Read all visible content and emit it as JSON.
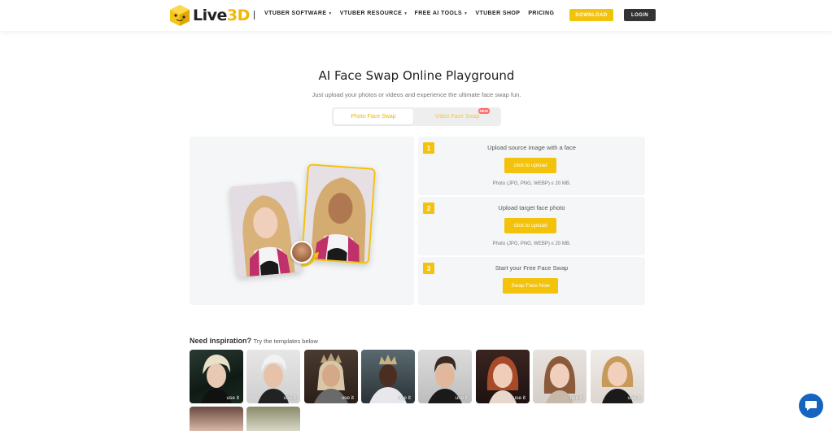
{
  "header": {
    "logo_text_main": "Live",
    "logo_text_accent": "3D",
    "nav": [
      {
        "label": "VTUBER SOFTWARE",
        "has_dropdown": true
      },
      {
        "label": "VTUBER RESOURCE",
        "has_dropdown": true
      },
      {
        "label": "FREE AI TOOLS",
        "has_dropdown": true
      },
      {
        "label": "VTUBER SHOP",
        "has_dropdown": false
      },
      {
        "label": "PRICING",
        "has_dropdown": false
      }
    ],
    "download_label": "DOWNLOAD",
    "login_label": "LOGIN"
  },
  "hero": {
    "title": "AI Face Swap Online Playground",
    "subtitle": "Just upload your photos or videos and experience the ultimate face swap fun."
  },
  "tabs": {
    "photo_label": "Photo Face Swap",
    "video_label": "Video Face Swap",
    "video_badge": "NEW",
    "active": "photo"
  },
  "steps": [
    {
      "number": "1",
      "title": "Upload source image with a face",
      "button": "click to upload",
      "note": "Photo (JPG, PNG, WEBP) ≤ 20 MB."
    },
    {
      "number": "2",
      "title": "Upload target face photo",
      "button": "click to upload",
      "note": "Photo (JPG, PNG, WEBP) ≤ 20 MB."
    },
    {
      "number": "3",
      "title": "Start your Free Face Swap",
      "button": "Swap Face Now"
    }
  ],
  "inspiration": {
    "heading": "Need inspiration?",
    "subheading": "Try the templates below",
    "use_label": "use it"
  },
  "colors": {
    "accent": "#f2c20c",
    "dark_button": "#333333",
    "chat_button": "#1565c0"
  }
}
